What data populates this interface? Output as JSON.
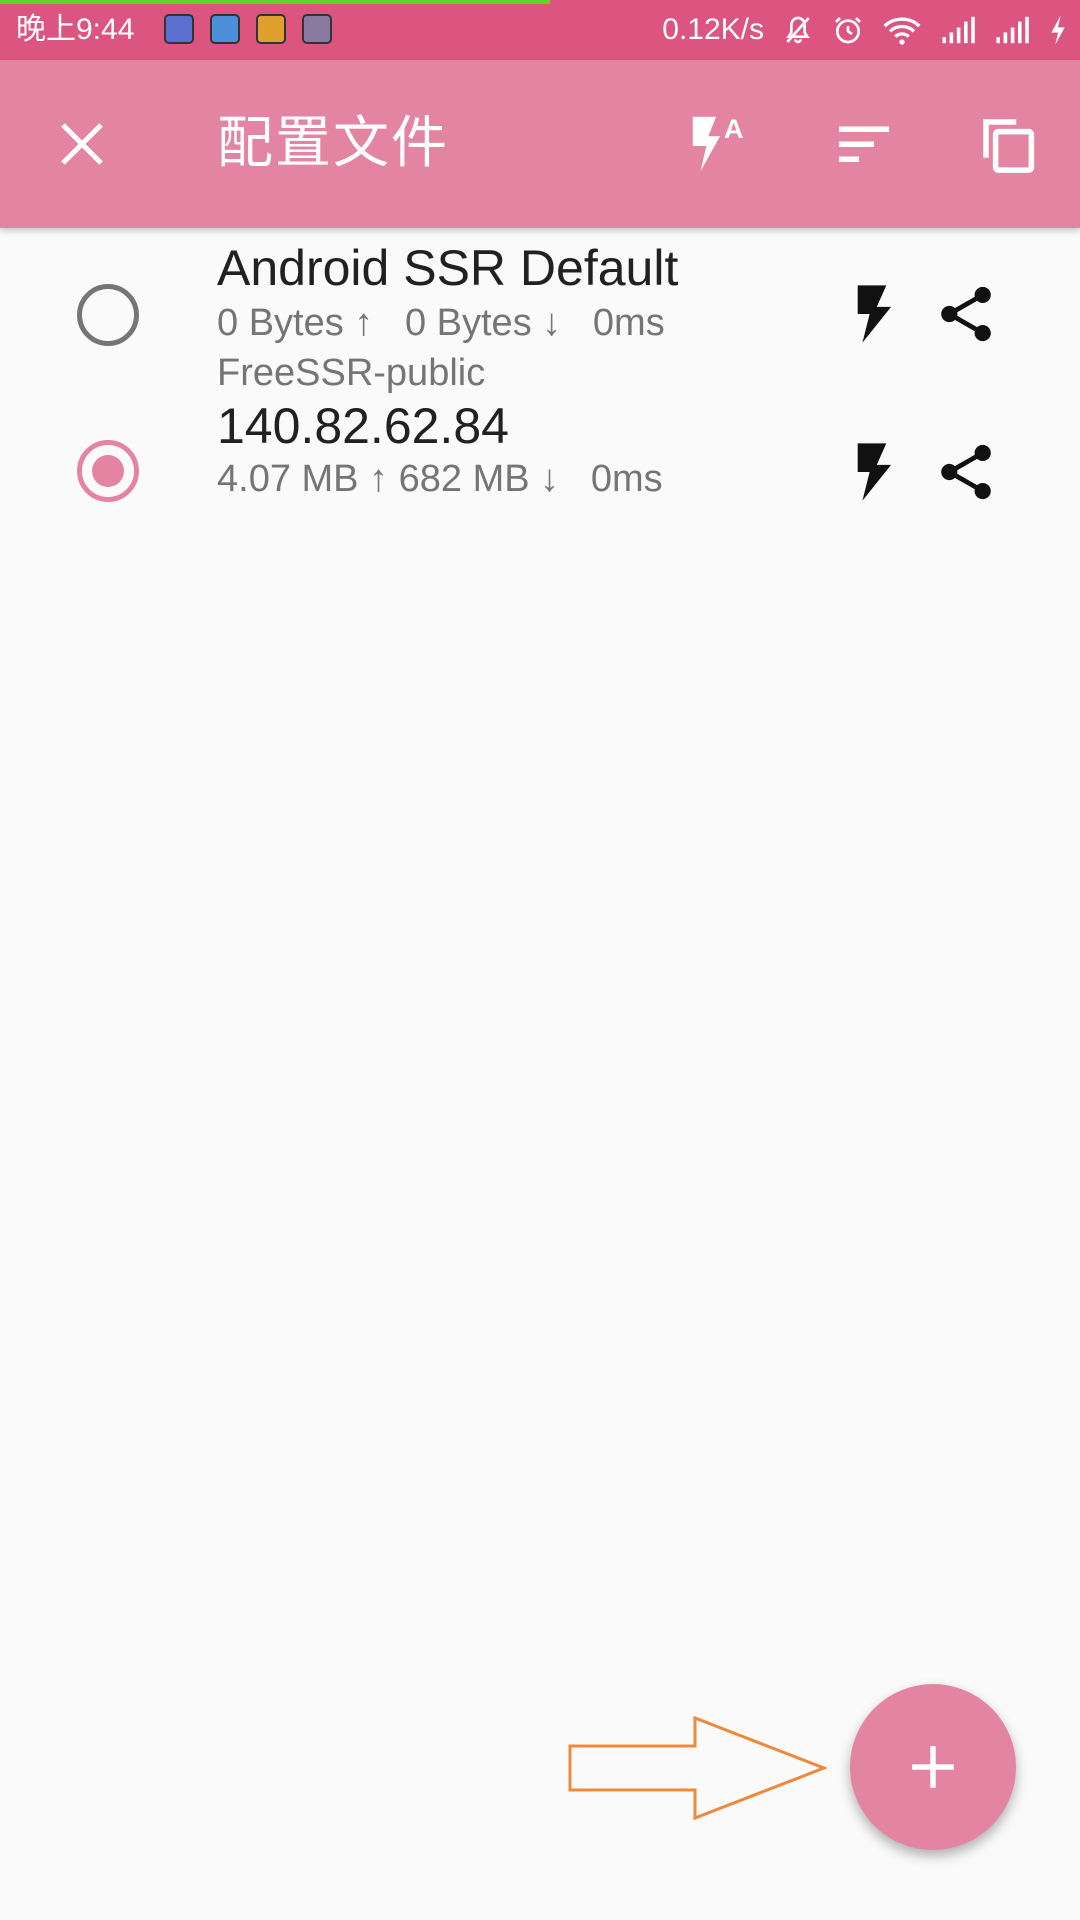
{
  "status_bar": {
    "time": "晚上9:44",
    "network_speed": "0.12K/s",
    "notification_icons": [
      "du-app-icon",
      "upload-app-icon",
      "game-app-icon",
      "grid-app-icon"
    ],
    "system_icons": [
      "muted-bell-icon",
      "alarm-icon",
      "wifi-icon",
      "signal-icon",
      "signal-icon",
      "charging-icon"
    ],
    "bar_color": "#dc5580"
  },
  "app_bar": {
    "title": "配置文件",
    "close_icon": "close-icon",
    "actions": [
      "auto-connect-test-icon",
      "sort-icon",
      "copy-icon"
    ],
    "color": "#e484a3"
  },
  "profiles": [
    {
      "name": "Android SSR Default",
      "stats": "0 Bytes ↑   0 Bytes ↓   0ms",
      "group": "FreeSSR-public",
      "selected": false
    },
    {
      "name": "140.82.62.84",
      "stats": "4.07 MB ↑ 682 MB ↓   0ms",
      "group": "",
      "selected": true
    }
  ],
  "row_actions": [
    "test-connection-icon",
    "share-icon"
  ],
  "fab": {
    "icon": "plus-icon",
    "color": "#e484a3"
  },
  "annotation": {
    "arrow_color": "#f0883a"
  }
}
